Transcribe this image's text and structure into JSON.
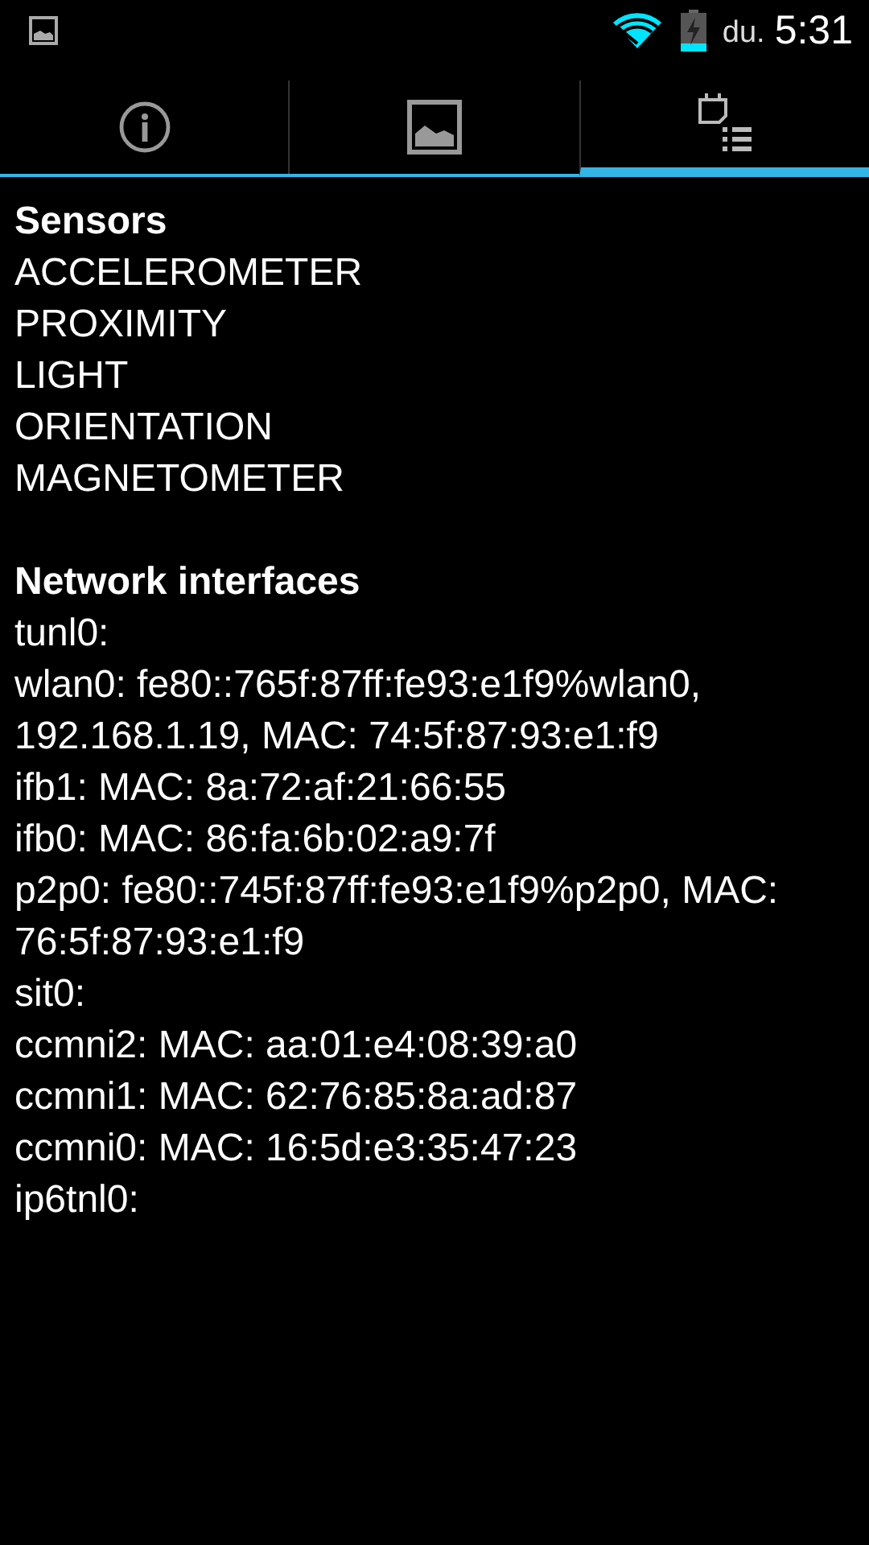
{
  "status_bar": {
    "period": "du.",
    "time": "5:31"
  },
  "tabs": [
    {
      "kind": "info",
      "selected": false
    },
    {
      "kind": "image",
      "selected": false
    },
    {
      "kind": "list",
      "selected": true
    }
  ],
  "sections": [
    {
      "title": "Sensors",
      "items": [
        "ACCELEROMETER",
        "PROXIMITY",
        "LIGHT",
        "ORIENTATION",
        "MAGNETOMETER"
      ]
    },
    {
      "title": "Network interfaces",
      "items": [
        "tunl0:",
        "wlan0: fe80::765f:87ff:fe93:e1f9%wlan0, 192.168.1.19, MAC: 74:5f:87:93:e1:f9",
        "ifb1: MAC: 8a:72:af:21:66:55",
        "ifb0: MAC: 86:fa:6b:02:a9:7f",
        "p2p0: fe80::745f:87ff:fe93:e1f9%p2p0, MAC: 76:5f:87:93:e1:f9",
        "sit0:",
        "ccmni2: MAC: aa:01:e4:08:39:a0",
        "ccmni1: MAC: 62:76:85:8a:ad:87",
        "ccmni0: MAC: 16:5d:e3:35:47:23",
        "ip6tnl0:"
      ]
    }
  ]
}
